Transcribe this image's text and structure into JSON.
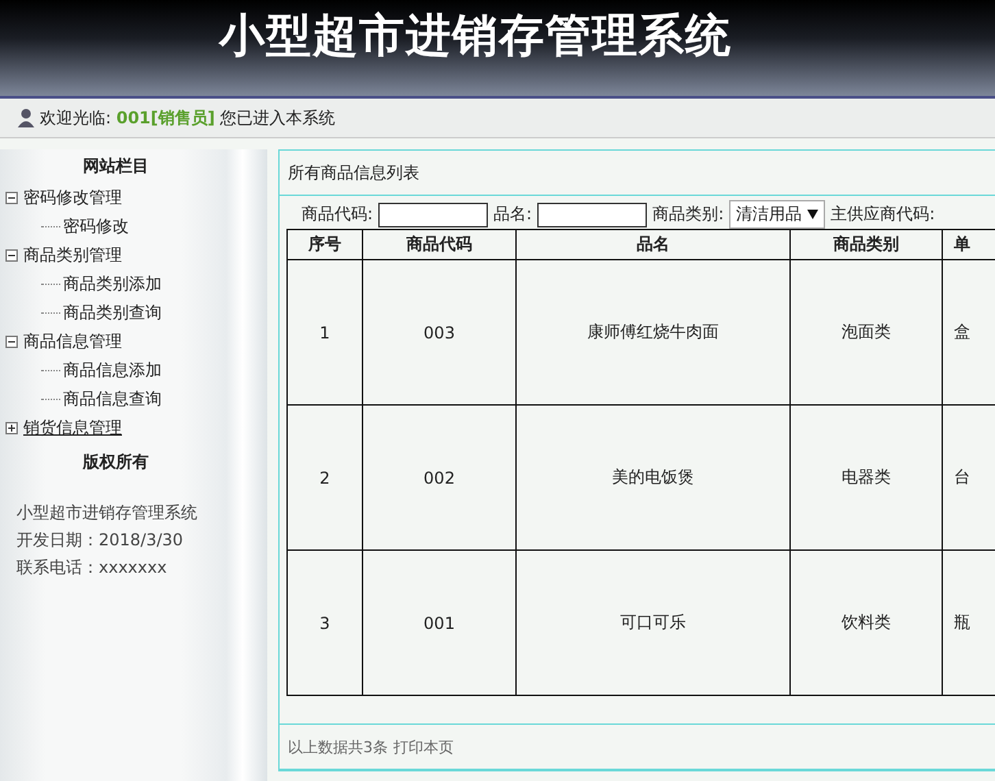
{
  "header": {
    "title": "小型超市进销存管理系统"
  },
  "welcome": {
    "text": "欢迎光临: **001[销售员]** 您已进入本系统"
  },
  "sidebar": {
    "title": "网站栏目",
    "items": [
      {
        "label": "密码修改管理",
        "expanded": true,
        "children": [
          {
            "label": "密码修改"
          }
        ]
      },
      {
        "label": "商品类别管理",
        "expanded": true,
        "children": [
          {
            "label": "商品类别添加"
          },
          {
            "label": "商品类别查询"
          }
        ]
      },
      {
        "label": "商品信息管理",
        "expanded": true,
        "children": [
          {
            "label": "商品信息添加"
          },
          {
            "label": "商品信息查询"
          }
        ]
      },
      {
        "label": "销货信息管理",
        "expanded": false
      }
    ],
    "copyright_title": "版权所有",
    "info": [
      "小型超市进销存管理系统",
      "开发日期：2018/3/30",
      "联系电话：xxxxxxx"
    ]
  },
  "panel": {
    "title": "所有商品信息列表",
    "filters": [
      {
        "kind": "input",
        "label": "商品代码:"
      },
      {
        "kind": "input",
        "label": "品名:"
      },
      {
        "kind": "select",
        "label": "商品类别:",
        "value": "清洁用品"
      },
      {
        "kind": "label",
        "label": "主供应商代码:"
      }
    ],
    "table": {
      "columns": [
        "序号",
        "商品代码",
        "品名",
        "商品类别",
        "单"
      ],
      "rows": [
        [
          "1",
          "003",
          "康师傅红烧牛肉面",
          "泡面类",
          "盒"
        ],
        [
          "2",
          "002",
          "美的电饭煲",
          "电器类",
          "台"
        ],
        [
          "3",
          "001",
          "可口可乐",
          "饮料类",
          "瓶"
        ]
      ]
    },
    "footer": {
      "text": "以上数据共3条",
      "link": "打印本页"
    }
  }
}
